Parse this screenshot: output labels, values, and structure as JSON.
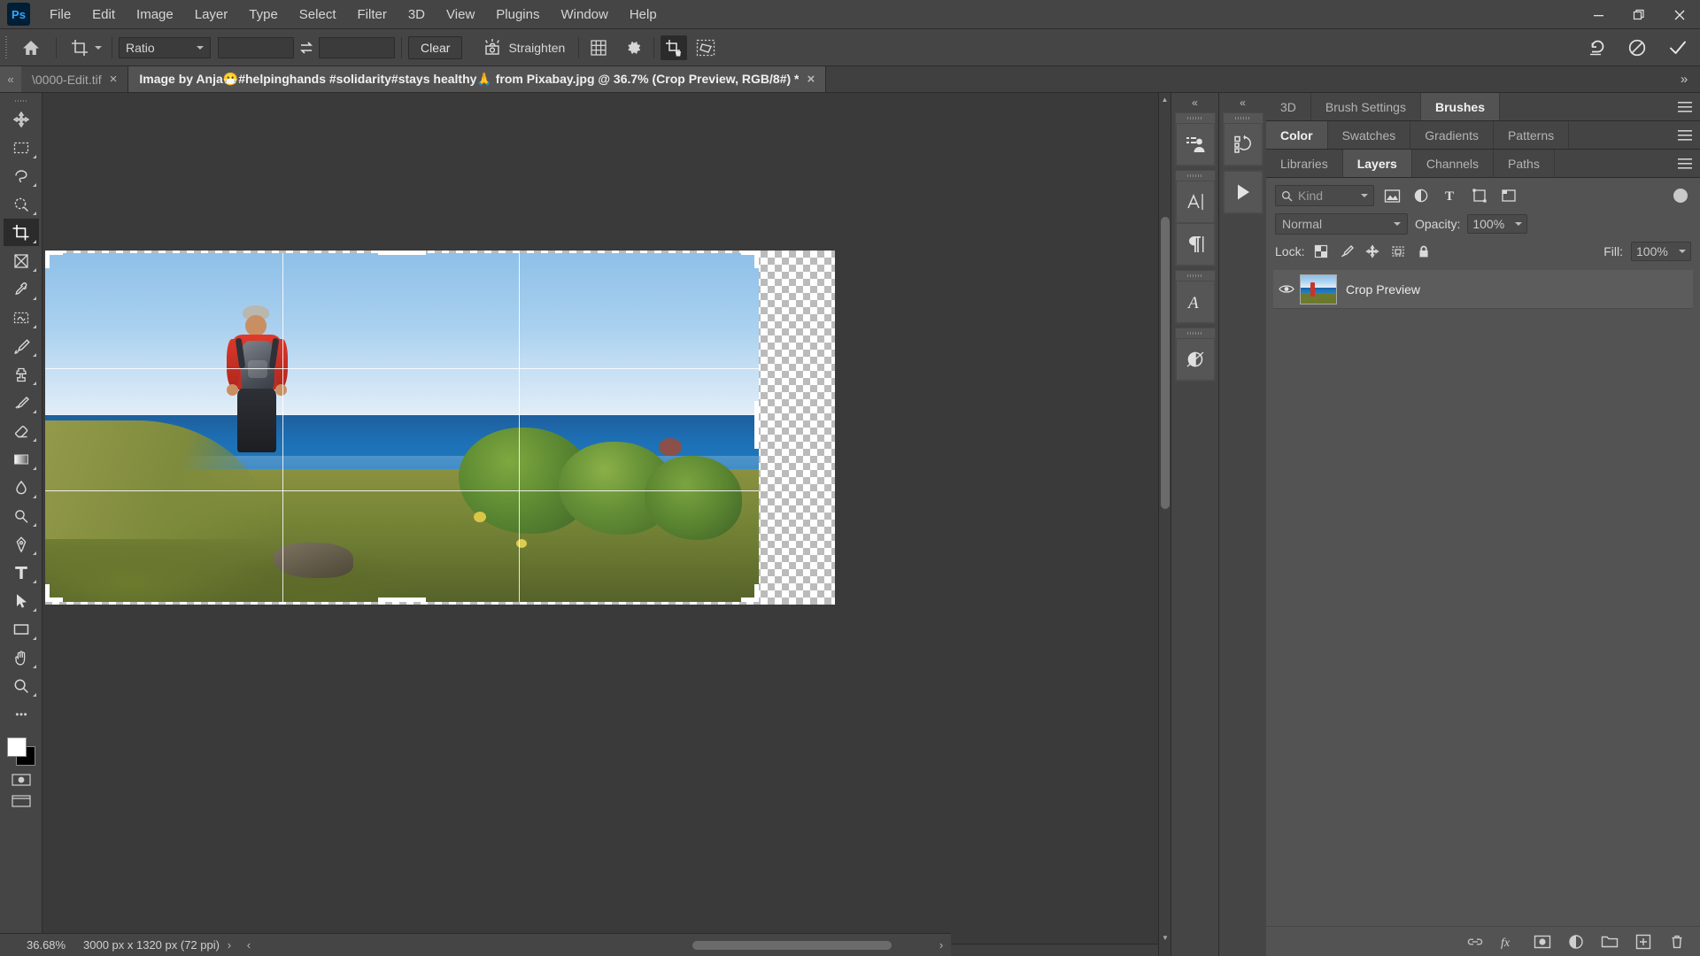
{
  "app": {
    "logo": "Ps",
    "name": "Adobe Photoshop"
  },
  "menubar": {
    "items": [
      "File",
      "Edit",
      "Image",
      "Layer",
      "Type",
      "Select",
      "Filter",
      "3D",
      "View",
      "Plugins",
      "Window",
      "Help"
    ],
    "window_controls": {
      "minimize": "minimize-icon",
      "restore": "restore-icon",
      "close": "close-icon"
    }
  },
  "options_bar": {
    "home_icon": "home-icon",
    "tool_icon": "crop-tool-icon",
    "ratio_label": "Ratio",
    "width_value": "",
    "height_value": "",
    "swap_icon": "swap-arrows-icon",
    "clear_label": "Clear",
    "straighten_label": "Straighten",
    "straighten_icon": "straighten-icon",
    "overlay_icon": "grid-overlay-icon",
    "settings_icon": "gear-icon",
    "delete_cropped_icon": "delete-cropped-pixels-icon",
    "content_aware_icon": "content-aware-icon",
    "reset_icon": "reset-icon",
    "cancel_icon": "cancel-icon",
    "commit_icon": "commit-checkmark-icon"
  },
  "tabs": {
    "scroll_left_icon": "chevron-double-left-icon",
    "items": [
      {
        "title": "\\0000-Edit.tif",
        "active": false,
        "close": "×"
      },
      {
        "title": "Image by Anja😷#helpinghands #solidarity#stays healthy🙏 from Pixabay.jpg @ 36.7% (Crop Preview, RGB/8#) *",
        "active": true,
        "close": "×"
      }
    ],
    "overflow_icon": "»"
  },
  "toolbar": {
    "tools": [
      {
        "name": "move-tool",
        "icon": "move-icon"
      },
      {
        "name": "rectangular-marquee-tool",
        "icon": "marquee-icon"
      },
      {
        "name": "lasso-tool",
        "icon": "lasso-icon"
      },
      {
        "name": "object-selection-tool",
        "icon": "quick-select-icon"
      },
      {
        "name": "crop-tool",
        "icon": "crop-icon",
        "active": true
      },
      {
        "name": "frame-tool",
        "icon": "frame-icon"
      },
      {
        "name": "eyedropper-tool",
        "icon": "eyedropper-icon"
      },
      {
        "name": "spot-healing-brush-tool",
        "icon": "healing-icon"
      },
      {
        "name": "brush-tool",
        "icon": "brush-icon"
      },
      {
        "name": "clone-stamp-tool",
        "icon": "stamp-icon"
      },
      {
        "name": "history-brush-tool",
        "icon": "history-brush-icon"
      },
      {
        "name": "eraser-tool",
        "icon": "eraser-icon"
      },
      {
        "name": "gradient-tool",
        "icon": "gradient-icon"
      },
      {
        "name": "blur-tool",
        "icon": "blur-icon"
      },
      {
        "name": "dodge-tool",
        "icon": "dodge-icon"
      },
      {
        "name": "pen-tool",
        "icon": "pen-icon"
      },
      {
        "name": "type-tool",
        "icon": "type-icon"
      },
      {
        "name": "path-selection-tool",
        "icon": "path-select-icon"
      },
      {
        "name": "rectangle-tool",
        "icon": "rectangle-icon"
      },
      {
        "name": "hand-tool",
        "icon": "hand-icon"
      },
      {
        "name": "zoom-tool",
        "icon": "zoom-icon"
      },
      {
        "name": "edit-toolbar",
        "icon": "ellipsis-icon"
      }
    ],
    "foreground_color": "#ffffff",
    "background_color": "#000000",
    "screen_mode_icon": "screen-mode-icon",
    "quick_mask_icon": "quick-mask-icon"
  },
  "canvas": {
    "document_open": true,
    "crop_preview": true,
    "grid_overlay": "rule-of-thirds"
  },
  "icon_dock": {
    "collapse_icon": "chevron-double-left-icon",
    "column_one": [
      "clone-source-panel-icon",
      "character-panel-icon",
      "paragraph-panel-icon",
      "glyphs-panel-icon",
      "adjustments-panel-icon"
    ],
    "column_two": [
      "history-panel-icon",
      "actions-play-icon"
    ]
  },
  "panels": {
    "row1": {
      "tabs": [
        "3D",
        "Brush Settings",
        "Brushes"
      ],
      "active": "Brushes",
      "menu_icon": "panel-menu-icon"
    },
    "row2": {
      "tabs": [
        "Color",
        "Swatches",
        "Gradients",
        "Patterns"
      ],
      "active": "Color",
      "menu_icon": "panel-menu-icon"
    },
    "row3": {
      "tabs": [
        "Libraries",
        "Layers",
        "Channels",
        "Paths"
      ],
      "active": "Layers",
      "menu_icon": "panel-menu-icon"
    }
  },
  "layers_panel": {
    "filter": {
      "search_icon": "search-icon",
      "kind_label": "Kind",
      "dropdown_icon": "chevron-down-icon",
      "type_filters": [
        "pixel-layer-filter-icon",
        "adjustment-layer-filter-icon",
        "type-layer-filter-icon",
        "shape-layer-filter-icon",
        "smart-object-filter-icon"
      ],
      "toggle_icon": "filter-toggle-switch"
    },
    "blend_mode": "Normal",
    "opacity_label": "Opacity:",
    "opacity_value": "100%",
    "fill_label": "Fill:",
    "fill_value": "100%",
    "lock_label": "Lock:",
    "lock_icons": [
      "lock-transparent-pixels-icon",
      "lock-image-pixels-icon",
      "lock-position-icon",
      "lock-artboard-nesting-icon",
      "lock-all-icon"
    ],
    "layers": [
      {
        "name": "Crop Preview",
        "visible": true,
        "visibility_icon": "eye-icon",
        "thumbnail": "layer-thumbnail",
        "selected": true
      }
    ],
    "footer_icons": [
      "link-layers-icon",
      "layer-style-fx-icon",
      "add-layer-mask-icon",
      "new-adjustment-layer-icon",
      "new-group-icon",
      "new-layer-icon",
      "delete-layer-icon"
    ]
  },
  "status_bar": {
    "zoom": "36.68%",
    "doc_info": "3000 px x 1320 px (72 ppi)",
    "expand_icon": "›",
    "scroll_left_icon": "‹",
    "scroll_right_icon": "›"
  },
  "colors": {
    "app_bg": "#535353",
    "panel_bg": "#454545",
    "canvas_bg": "#3a3a3a",
    "accent": "#31a8ff",
    "text": "#d4d4d4"
  }
}
